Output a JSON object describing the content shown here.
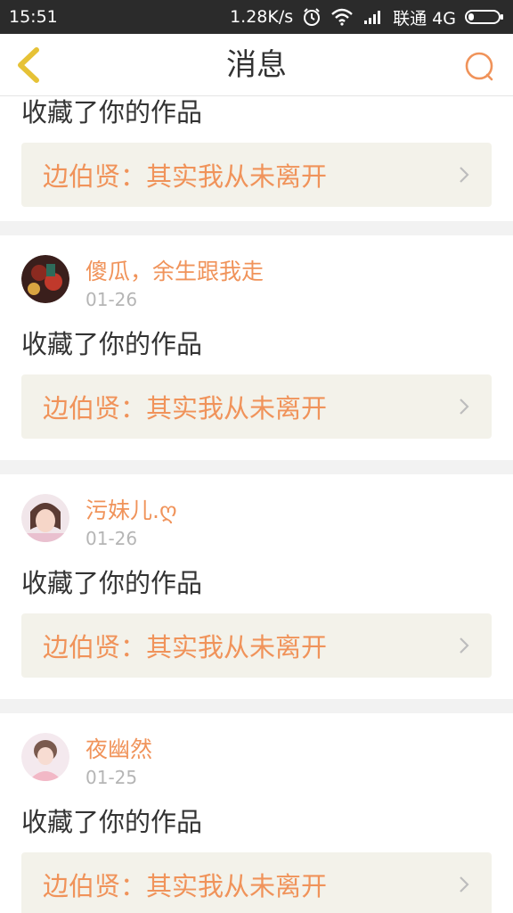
{
  "status_bar": {
    "time": "15:51",
    "speed": "1.28K/s",
    "carrier": "联通 4G"
  },
  "header": {
    "title": "消息"
  },
  "notifications": [
    {
      "action": "收藏了你的作品",
      "work": "边伯贤：其实我从未离开"
    },
    {
      "username": "傻瓜，余生跟我走",
      "date": "01-26",
      "action": "收藏了你的作品",
      "work": "边伯贤：其实我从未离开"
    },
    {
      "username": "污妹儿.ღ",
      "date": "01-26",
      "action": "收藏了你的作品",
      "work": "边伯贤：其实我从未离开"
    },
    {
      "username": "夜幽然",
      "date": "01-25",
      "action": "收藏了你的作品",
      "work": "边伯贤：其实我从未离开"
    }
  ],
  "colors": {
    "accent": "#f0935a",
    "back_icon": "#e6c236",
    "work_bg": "#f3f2ea"
  }
}
